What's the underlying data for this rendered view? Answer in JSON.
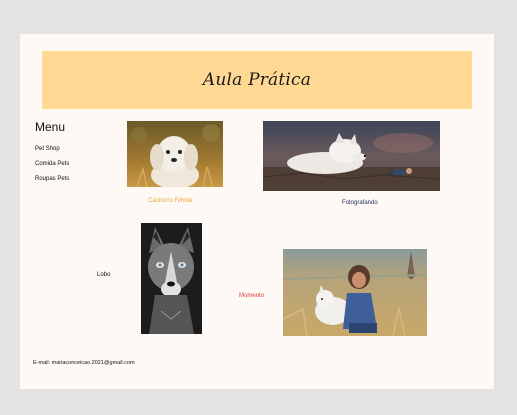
{
  "header": {
    "title": "Aula Prática"
  },
  "menu": {
    "title": "Menu",
    "items": [
      {
        "label": "Pet Shop"
      },
      {
        "label": "Comida Pets"
      },
      {
        "label": "Roupas Pets"
      }
    ]
  },
  "gallery": {
    "puppy_caption": "Cachorro Filhote",
    "photographing_caption": "Fotografando",
    "wolf_caption": "Lobo",
    "moment_caption": "Momento"
  },
  "footer": {
    "email": "E-mail: mariaconceicao.2021@gmail.com"
  },
  "colors": {
    "page_bg": "#fff9f6",
    "header_bg": "#ffd993",
    "puppy_caption": "#e8a832",
    "photographing_caption": "#1a2f55",
    "moment_caption": "#d8403a"
  }
}
